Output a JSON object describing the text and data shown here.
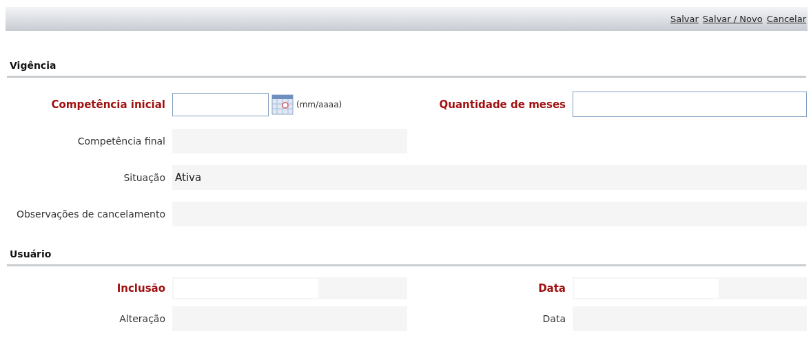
{
  "toolbar": {
    "links": [
      "Salvar",
      "Salvar / Novo",
      "Cancelar"
    ]
  },
  "sections": [
    {
      "title": "Vigência",
      "rows": [
        {
          "fields": [
            {
              "label": "Competência inicial",
              "required": true,
              "kind": "date_input",
              "hint": "(mm/aaaa)"
            },
            {
              "label": "Quantidade de meses",
              "required": true,
              "kind": "input"
            }
          ]
        },
        {
          "fields": [
            {
              "label": "Competência final",
              "required": false,
              "kind": "readonly"
            }
          ]
        },
        {
          "fields": [
            {
              "label": "Situação",
              "required": false,
              "kind": "readonly_wide",
              "value": "Ativa"
            }
          ]
        },
        {
          "fields": [
            {
              "label": "Observações de cancelamento",
              "required": false,
              "kind": "readonly_wide"
            }
          ]
        }
      ]
    },
    {
      "title": "Usuário",
      "rows": [
        {
          "fields": [
            {
              "label": "Inclusão",
              "required": true,
              "kind": "readonly_boxed"
            },
            {
              "label": "Data",
              "required": true,
              "kind": "readonly_boxed"
            }
          ]
        },
        {
          "fields": [
            {
              "label": "Alteração",
              "required": false,
              "kind": "readonly"
            },
            {
              "label": "Data",
              "required": false,
              "kind": "readonly"
            }
          ]
        }
      ]
    }
  ]
}
